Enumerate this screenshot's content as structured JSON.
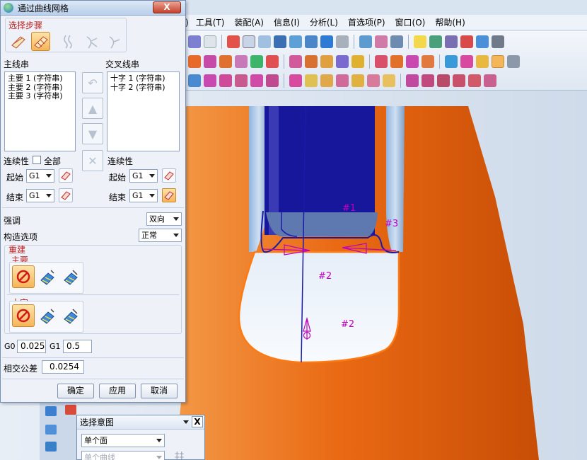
{
  "menu": {
    "items": [
      "",
      "工具(T)",
      "装配(A)",
      "信息(I)",
      "分析(L)",
      "首选项(P)",
      "窗口(O)",
      "帮助(H)"
    ]
  },
  "dialog": {
    "title": "通过曲线网格",
    "close_label": "X",
    "steps_label": "选择步骤",
    "primary_label": "主线串",
    "primary_items": [
      "主要 1 (字符串)",
      "主要 2 (字符串)",
      "主要 3 (字符串)"
    ],
    "cross_label": "交叉线串",
    "cross_items": [
      "十字 1 (字符串)",
      "十字 2 (字符串)"
    ],
    "continuity_label": "连续性",
    "all_label": "全部",
    "start_label": "起始",
    "end_label": "结束",
    "g1": "G1",
    "emphasis_label": "强调",
    "emphasis_value": "双向",
    "construct_label": "构造选项",
    "construct_value": "正常",
    "rebuild_label": "重建",
    "main_label": "主要",
    "cross_sub_label": "十字",
    "g0_label": "G0",
    "g0_value": "0.025",
    "g1_label": "G1",
    "g1_value": "0.5",
    "tolerance_label": "相交公差",
    "tolerance_value": "0.0254",
    "ok": "确定",
    "apply": "应用",
    "cancel": "取消"
  },
  "viewport": {
    "labels": [
      "#1",
      "#3",
      "#2",
      "#2"
    ]
  },
  "intent_panel": {
    "title": "选择意图",
    "close_label": "X",
    "face_option": "单个面",
    "curve_option": "单个曲线"
  },
  "colors": {
    "orange": "#f06a10",
    "blue": "#1a1aa0",
    "magenta": "#c000c0"
  }
}
